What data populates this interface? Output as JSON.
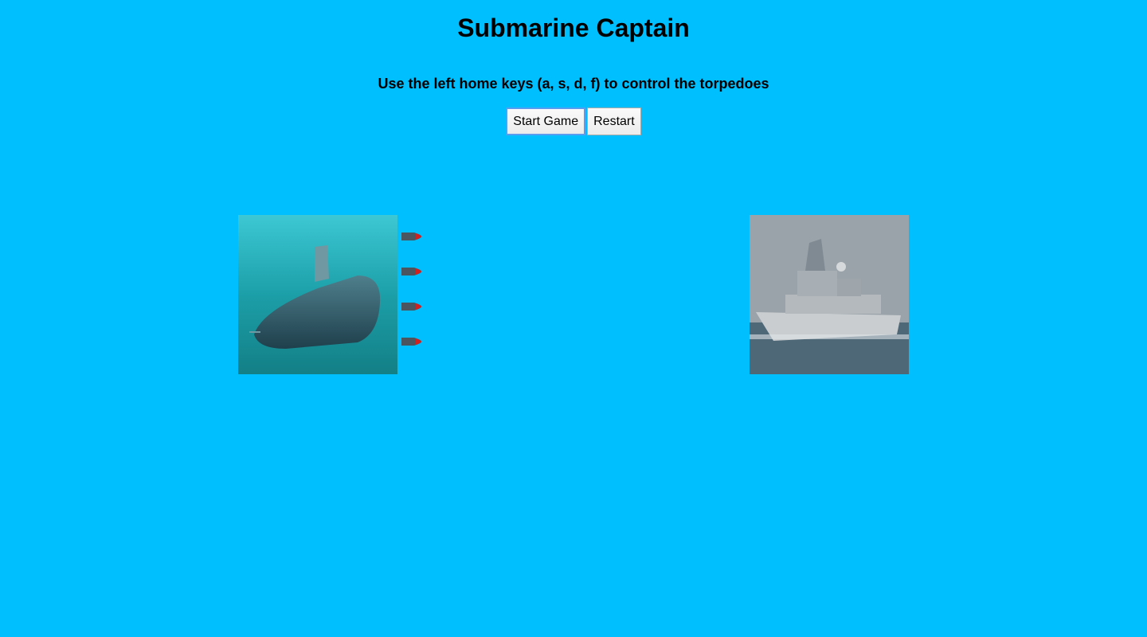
{
  "title": "Submarine Captain",
  "instructions": "Use the left home keys (a, s, d, f) to control the torpedoes",
  "buttons": {
    "start": "Start Game",
    "restart": "Restart"
  },
  "torpedo_count": 4
}
